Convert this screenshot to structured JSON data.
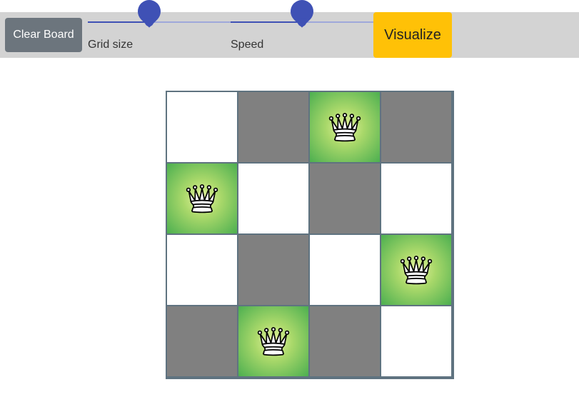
{
  "toolbar": {
    "clear_label": "Clear Board",
    "grid_size_label": "Grid size",
    "speed_label": "Speed",
    "visualize_label": "Visualize",
    "grid_size_fraction": 0.43,
    "speed_fraction": 0.5
  },
  "board": {
    "size": 4,
    "queens": [
      [
        0,
        2
      ],
      [
        1,
        0
      ],
      [
        2,
        3
      ],
      [
        3,
        1
      ]
    ]
  },
  "colors": {
    "toolbar_bg": "#d3d3d3",
    "clear_button": "#6c757d",
    "visualize_button": "#ffc107",
    "slider_accent": "#3f51b5",
    "light_square": "#ffffff",
    "dark_square": "#808080",
    "queen_highlight": "#4caf50"
  },
  "icons": {
    "queen": "white-queen-icon"
  }
}
